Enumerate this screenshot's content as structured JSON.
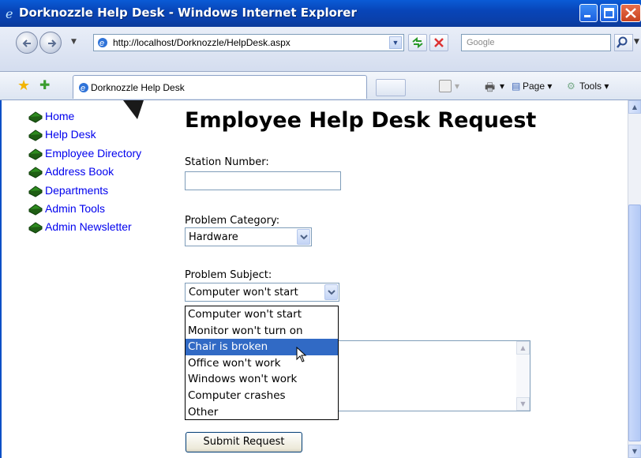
{
  "window": {
    "title": "Dorknozzle Help Desk - Windows Internet Explorer"
  },
  "address_bar": {
    "url": "http://localhost/Dorknozzle/HelpDesk.aspx",
    "search_placeholder": "Google"
  },
  "tab": {
    "label": "Dorknozzle Help Desk"
  },
  "command_bar": {
    "page_label": "Page ▾",
    "tools_label": "Tools ▾"
  },
  "sidebar": {
    "items": [
      {
        "label": "Home"
      },
      {
        "label": "Help Desk"
      },
      {
        "label": "Employee Directory"
      },
      {
        "label": "Address Book"
      },
      {
        "label": "Departments"
      },
      {
        "label": "Admin Tools"
      },
      {
        "label": "Admin Newsletter"
      }
    ]
  },
  "form": {
    "heading": "Employee Help Desk Request",
    "station_label": "Station Number:",
    "station_value": "",
    "category_label": "Problem Category:",
    "category_value": "Hardware",
    "subject_label": "Problem Subject:",
    "subject_value": "Computer won't start",
    "subject_options": [
      {
        "label": "Computer won't start",
        "highlighted": false
      },
      {
        "label": "Monitor won't turn on",
        "highlighted": false
      },
      {
        "label": "Chair is broken",
        "highlighted": true
      },
      {
        "label": "Office won't work",
        "highlighted": false
      },
      {
        "label": "Windows won't work",
        "highlighted": false
      },
      {
        "label": "Computer crashes",
        "highlighted": false
      },
      {
        "label": "Other",
        "highlighted": false
      }
    ],
    "submit_label": "Submit Request"
  },
  "colors": {
    "titlebar": "#0845b8",
    "highlight": "#316ac5",
    "link": "#0000ee"
  }
}
